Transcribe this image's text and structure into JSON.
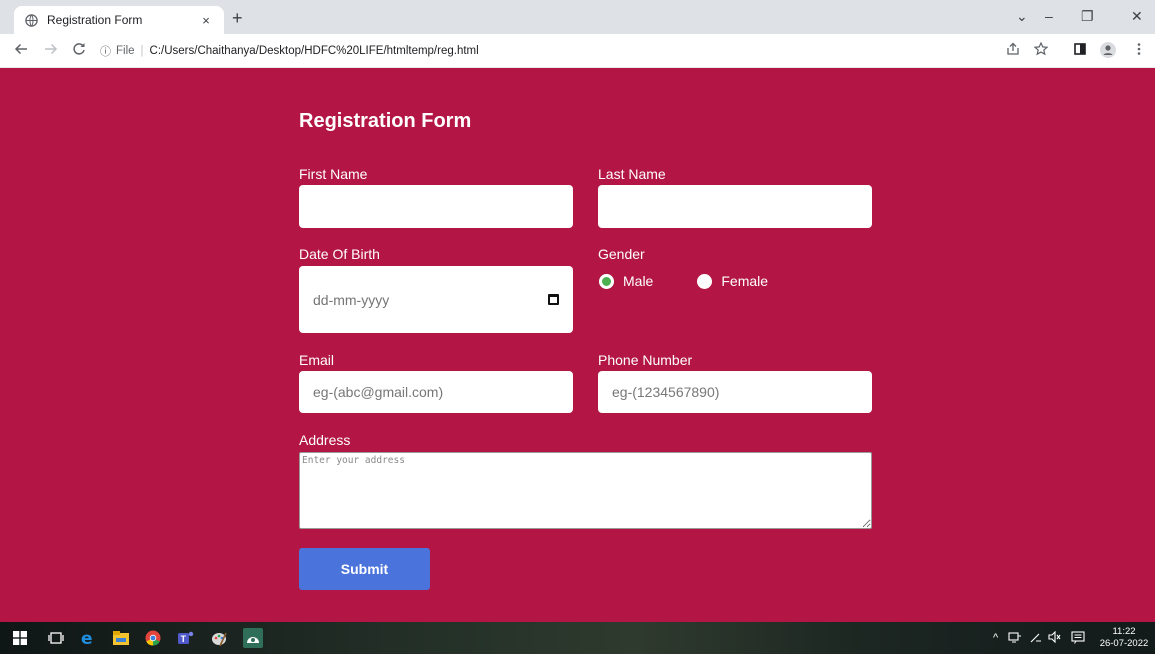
{
  "browser": {
    "tab_title": "Registration Form",
    "tab_close": "×",
    "new_tab": "+",
    "address": {
      "info_glyph": "ⓘ",
      "scheme": "File",
      "url": "C:/Users/Chaithanya/Desktop/HDFC%20LIFE/htmltemp/reg.html"
    },
    "controls": {
      "chevron": "⌄",
      "minimize": "–",
      "restore": "❐",
      "close": "✕"
    }
  },
  "form": {
    "title": "Registration Form",
    "first_name": {
      "label": "First Name",
      "value": ""
    },
    "last_name": {
      "label": "Last Name",
      "value": ""
    },
    "dob": {
      "label": "Date Of Birth",
      "placeholder": "dd-mm-yyyy"
    },
    "gender": {
      "label": "Gender",
      "options": [
        {
          "label": "Male",
          "checked": true
        },
        {
          "label": "Female",
          "checked": false
        }
      ]
    },
    "email": {
      "label": "Email",
      "placeholder": "eg-(abc@gmail.com)"
    },
    "phone": {
      "label": "Phone Number",
      "placeholder": "eg-(1234567890)"
    },
    "address": {
      "label": "Address",
      "placeholder": "Enter your address"
    },
    "submit_label": "Submit"
  },
  "taskbar": {
    "time": "11:22",
    "date": "26-07-2022",
    "tray_glyphs": "^"
  },
  "colors": {
    "page_bg": "#b31644",
    "submit_bg": "#4b73dc",
    "radio_checked": "#4caf50"
  }
}
